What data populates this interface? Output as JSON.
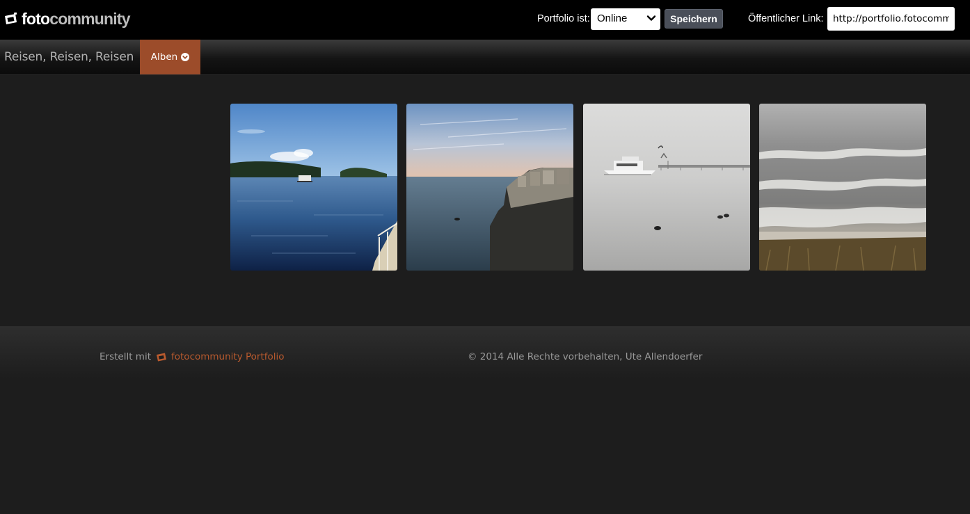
{
  "header": {
    "logo_text_bold": "foto",
    "logo_text_light": "community",
    "status_label": "Portfolio ist:",
    "status_value": "Online",
    "save_label": "Speichern",
    "link_label": "Öffentlicher Link:",
    "link_value": "http://portfolio.fotocommunity"
  },
  "nav": {
    "portfolio_title": "Reisen, Reisen, Reisen",
    "albums_label": "Alben",
    "albums_icon": "chevron-circle-down-icon"
  },
  "gallery": {
    "photos": [
      {
        "subject": "lake-with-houseboat"
      },
      {
        "subject": "coastal-cliff-town-at-dusk"
      },
      {
        "subject": "motor-yacht-and-pier-in-fog"
      },
      {
        "subject": "stormy-sea-waves-and-dune-grass"
      }
    ]
  },
  "footer": {
    "credit_prefix": "Erstellt mit",
    "credit_link": "fotocommunity Portfolio",
    "copyright": "© 2014 Alle Rechte vorbehalten, Ute Allendoerfer"
  },
  "colors": {
    "accent": "#9c4c2a",
    "link": "#b85a2e",
    "background": "#1d1d1d",
    "topbar": "#000000"
  }
}
